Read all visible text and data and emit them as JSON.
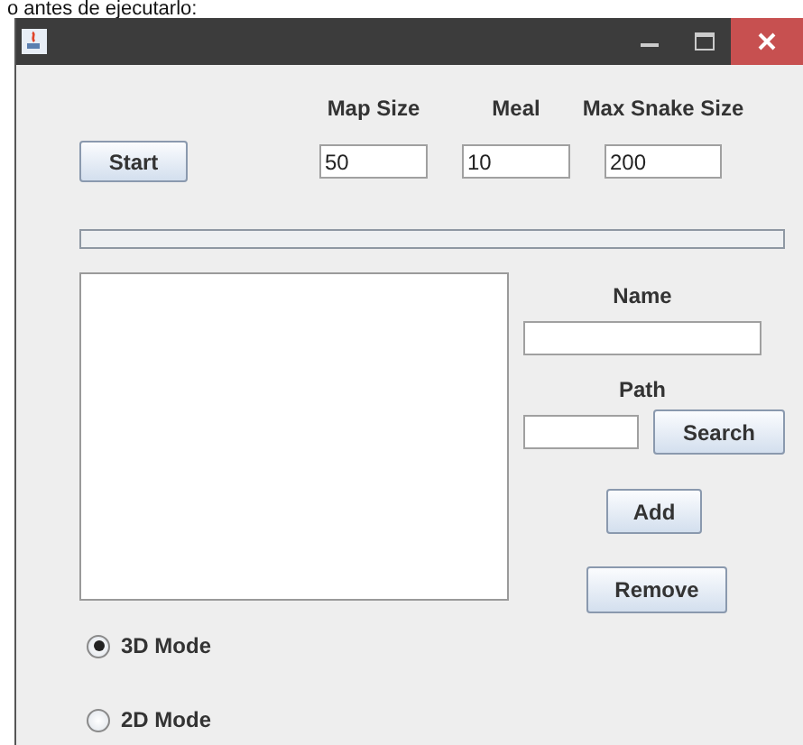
{
  "caption": "o antes de ejecutarlo:",
  "start_button": "Start",
  "settings": [
    {
      "label": "Map Size",
      "value": "50"
    },
    {
      "label": "Meal",
      "value": "10"
    },
    {
      "label": "Max Snake Size",
      "value": "200"
    }
  ],
  "name_label": "Name",
  "path_label": "Path",
  "search_button": "Search",
  "add_button": "Add",
  "remove_button": "Remove",
  "modes": [
    {
      "label": "3D Mode",
      "selected": true
    },
    {
      "label": "2D Mode",
      "selected": false
    }
  ]
}
